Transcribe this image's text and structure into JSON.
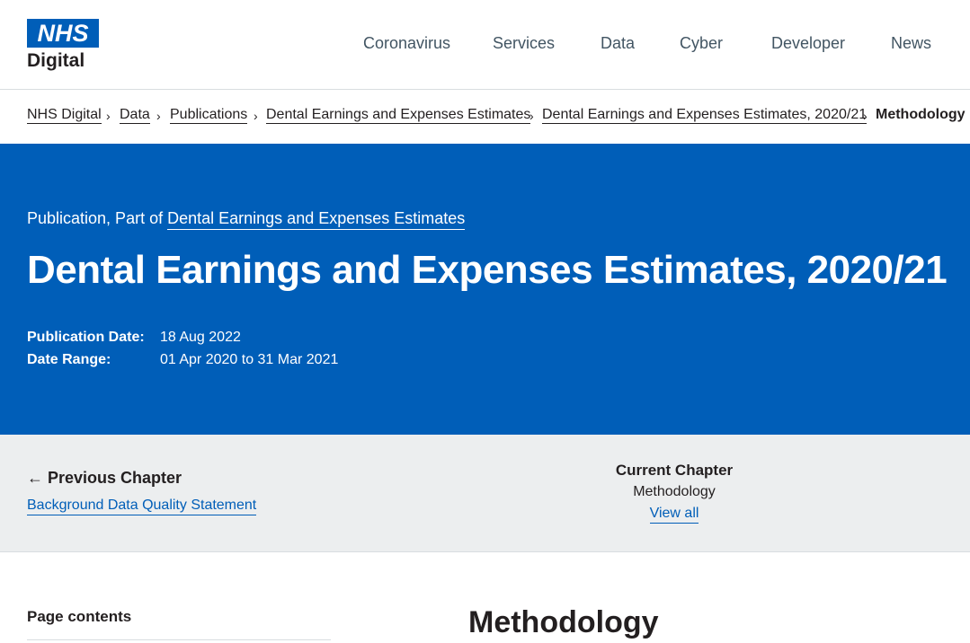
{
  "header": {
    "logo_top": "NHS",
    "logo_bottom": "Digital",
    "nav": [
      "Coronavirus",
      "Services",
      "Data",
      "Cyber",
      "Developer",
      "News"
    ]
  },
  "breadcrumb": {
    "items": [
      "NHS Digital",
      "Data",
      "Publications",
      "Dental Earnings and Expenses Estimates",
      "Dental Earnings and Expenses Estimates, 2020/21"
    ],
    "separator": "›",
    "current": "Methodology"
  },
  "hero": {
    "kicker_prefix": "Publication, Part of",
    "kicker_link": "Dental Earnings and Expenses Estimates",
    "title": "Dental Earnings and Expenses Estimates, 2020/21",
    "publication_date_label": "Publication Date:",
    "publication_date": "18 Aug 2022",
    "date_range_label": "Date Range:",
    "date_range": "01 Apr 2020 to 31 Mar 2021"
  },
  "chapter_nav": {
    "previous_heading": "Previous Chapter",
    "previous_arrow": "←",
    "previous_link": "Background Data Quality Statement",
    "current_heading": "Current Chapter",
    "current_name": "Methodology",
    "view_all": "View all"
  },
  "content": {
    "page_contents_label": "Page contents",
    "title": "Methodology"
  },
  "colors": {
    "brand_blue": "#005eb8",
    "text": "#231f20",
    "nav_text": "#425563",
    "band_grey": "#eceeef"
  }
}
